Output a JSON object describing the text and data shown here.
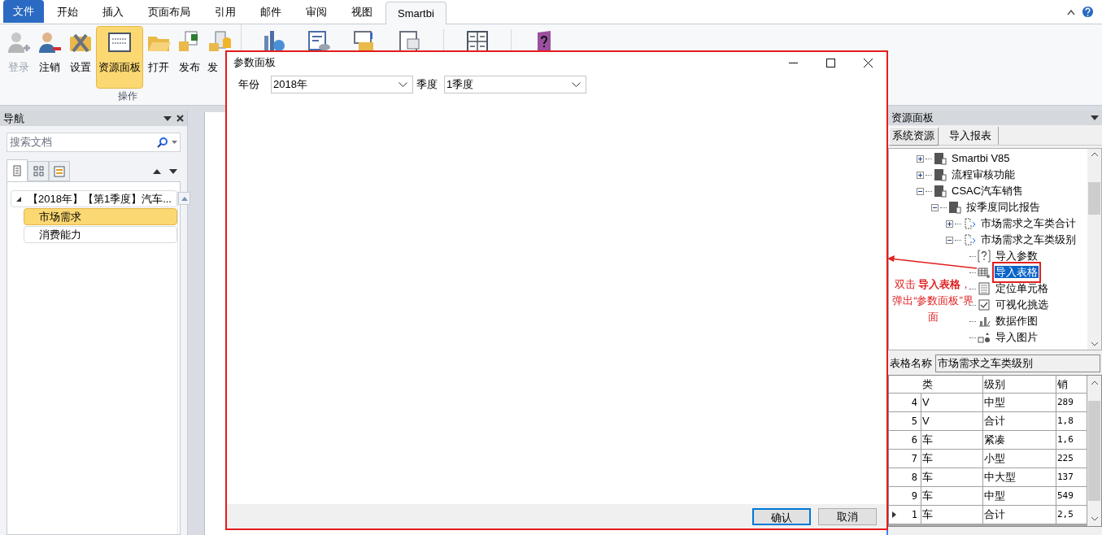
{
  "ribbon_tabs": [
    {
      "label": "文件",
      "kind": "file",
      "selected": false
    },
    {
      "label": "开始",
      "kind": "tab",
      "selected": false
    },
    {
      "label": "插入",
      "kind": "tab",
      "selected": false
    },
    {
      "label": "页面布局",
      "kind": "tab",
      "selected": false
    },
    {
      "label": "引用",
      "kind": "tab",
      "selected": false
    },
    {
      "label": "邮件",
      "kind": "tab",
      "selected": false
    },
    {
      "label": "审阅",
      "kind": "tab",
      "selected": false
    },
    {
      "label": "视图",
      "kind": "tab",
      "selected": false
    },
    {
      "label": "Smartbi",
      "kind": "tab",
      "selected": true
    }
  ],
  "ribbon_buttons": [
    {
      "label": "登录",
      "kind": "login",
      "disabled": true,
      "selected": false
    },
    {
      "label": "注销",
      "kind": "logout",
      "disabled": false,
      "selected": false
    },
    {
      "label": "设置",
      "kind": "settings",
      "disabled": false,
      "selected": false
    },
    {
      "label": "资源面板",
      "kind": "panel",
      "disabled": false,
      "selected": true
    },
    {
      "label": "打开",
      "kind": "open",
      "disabled": false,
      "selected": false
    },
    {
      "label": "发布",
      "kind": "publish",
      "disabled": false,
      "selected": false
    },
    {
      "label": "发",
      "kind": "database",
      "disabled": false,
      "selected": false
    }
  ],
  "ribbon_group": "操作",
  "nav": {
    "title": "导航",
    "search": {
      "placeholder": "搜索文档"
    },
    "view_tabs": [
      {
        "kind": "pages",
        "selected": true
      },
      {
        "kind": "grid",
        "selected": false
      },
      {
        "kind": "list",
        "selected": false
      }
    ],
    "tree": [
      {
        "label": "【2018年】【第1季度】汽车...",
        "expanded": true,
        "selected": false,
        "children": [
          {
            "label": "市场需求",
            "selected": true
          },
          {
            "label": "消费能力",
            "selected": false
          }
        ]
      }
    ]
  },
  "resource_panel": {
    "title": "资源面板",
    "tabs": [
      {
        "label": "系统资源",
        "selected": true
      },
      {
        "label": "导入报表",
        "selected": false
      }
    ],
    "tree": [
      {
        "label": "Smartbi V85",
        "kind": "folder",
        "expanded": false,
        "selected": false
      },
      {
        "label": "流程审核功能",
        "kind": "folder",
        "expanded": false,
        "selected": false
      },
      {
        "label": "CSAC汽车销售",
        "kind": "folder",
        "expanded": true,
        "selected": false,
        "children": [
          {
            "label": "按季度同比报告",
            "kind": "folder",
            "expanded": true,
            "selected": false,
            "children": [
              {
                "label": "市场需求之车类合计",
                "kind": "report",
                "expanded": false,
                "selected": false
              },
              {
                "label": "市场需求之车类级别",
                "kind": "report",
                "expanded": true,
                "selected": false,
                "children": [
                  {
                    "label": "导入参数",
                    "kind": "param",
                    "selected": false
                  },
                  {
                    "label": "导入表格",
                    "kind": "table",
                    "selected": true
                  },
                  {
                    "label": "定位单元格",
                    "kind": "cell",
                    "selected": false
                  },
                  {
                    "label": "可视化挑选",
                    "kind": "filter",
                    "selected": false
                  },
                  {
                    "label": "数据作图",
                    "kind": "chart",
                    "selected": false
                  },
                  {
                    "label": "导入图片",
                    "kind": "image",
                    "selected": false
                  }
                ]
              }
            ]
          }
        ]
      }
    ],
    "table_name_label": "表格名称",
    "table_name_value": "市场需求之车类级别",
    "table": {
      "columns": [
        "类",
        "级别",
        "销"
      ],
      "rows": [
        {
          "number": "4",
          "cells": [
            "V",
            "中型",
            "289"
          ],
          "current": false
        },
        {
          "number": "5",
          "cells": [
            "V",
            "合计",
            "1,8"
          ],
          "current": false
        },
        {
          "number": "6",
          "cells": [
            "车",
            "紧凑",
            "1,6"
          ],
          "current": false
        },
        {
          "number": "7",
          "cells": [
            "车",
            "小型",
            "225"
          ],
          "current": false
        },
        {
          "number": "8",
          "cells": [
            "车",
            "中大型",
            "137"
          ],
          "current": false
        },
        {
          "number": "9",
          "cells": [
            "车",
            "中型",
            "549"
          ],
          "current": false
        },
        {
          "number": "1",
          "cells": [
            "车",
            "合计",
            "2,5"
          ],
          "current": true
        }
      ]
    }
  },
  "annotation": "双击 **导入表格**，弹出“参数面板”界面",
  "dialog": {
    "title": "参数面板",
    "params": [
      {
        "label": "年份",
        "value": "2018年"
      },
      {
        "label": "季度",
        "value": "1季度"
      }
    ],
    "buttons": [
      {
        "label": "确认",
        "default": true
      },
      {
        "label": "取消",
        "default": false
      }
    ]
  }
}
